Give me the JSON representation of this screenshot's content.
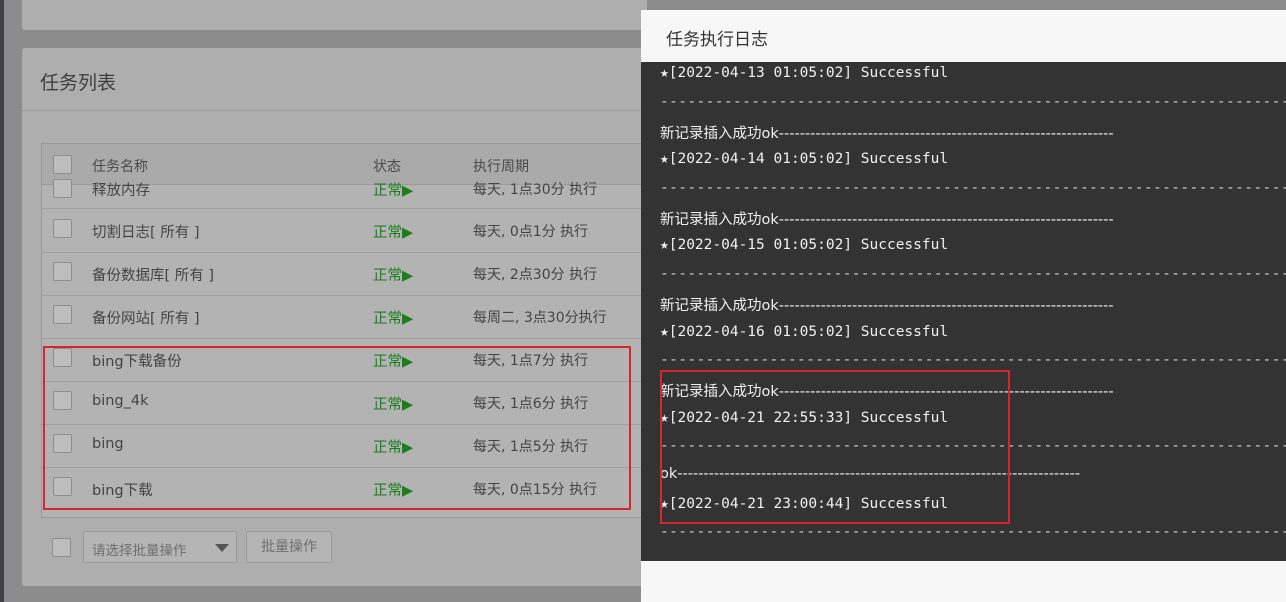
{
  "panel": {
    "title": "任务列表"
  },
  "table": {
    "headers": {
      "name": "任务名称",
      "status": "状态",
      "period": "执行周期"
    },
    "rows": [
      {
        "name": "释放内存",
        "status": "正常▶",
        "period": "每天, 1点30分 执行"
      },
      {
        "name": "切割日志[ 所有 ]",
        "status": "正常▶",
        "period": "每天, 0点1分 执行"
      },
      {
        "name": "备份数据库[ 所有 ]",
        "status": "正常▶",
        "period": "每天, 2点30分 执行"
      },
      {
        "name": "备份网站[ 所有 ]",
        "status": "正常▶",
        "period": "每周二, 3点30分执行"
      },
      {
        "name": "bing下载备份",
        "status": "正常▶",
        "period": "每天, 1点7分 执行"
      },
      {
        "name": "bing_4k",
        "status": "正常▶",
        "period": "每天, 1点6分 执行"
      },
      {
        "name": "bing",
        "status": "正常▶",
        "period": "每天, 1点5分 执行"
      },
      {
        "name": "bing下载",
        "status": "正常▶",
        "period": "每天, 0点15分 执行"
      }
    ]
  },
  "batch": {
    "placeholder": "请选择批量操作",
    "button": "批量操作"
  },
  "dialog": {
    "title": "任务执行日志",
    "lines": [
      "★[2022-04-13 01:05:02] Successful",
      "------------------------------------------------------------------------",
      "新记录插入成功ok----------------------------------------------------------------",
      "★[2022-04-14 01:05:02] Successful",
      "------------------------------------------------------------------------",
      "新记录插入成功ok----------------------------------------------------------------",
      "★[2022-04-15 01:05:02] Successful",
      "------------------------------------------------------------------------",
      "新记录插入成功ok----------------------------------------------------------------",
      "★[2022-04-16 01:05:02] Successful",
      "------------------------------------------------------------------------",
      "新记录插入成功ok----------------------------------------------------------------",
      "★[2022-04-21 22:55:33] Successful",
      "------------------------------------------------------------------------",
      "ok-----------------------------------------------------------------------------",
      "★[2022-04-21 23:00:44] Successful",
      "------------------------------------------------------------------------"
    ]
  },
  "colors": {
    "status_green": "#1a7f1a",
    "highlight_red": "#d8252b",
    "log_bg": "#333333"
  }
}
